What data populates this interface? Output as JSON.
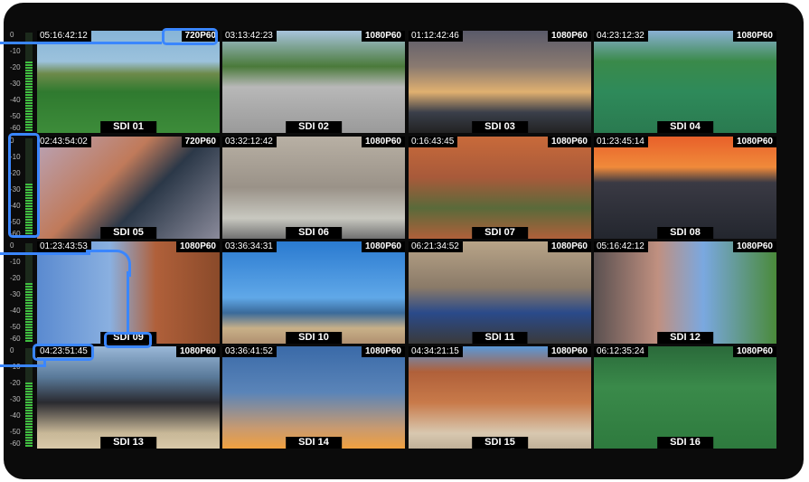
{
  "monitor": {
    "scale_labels": [
      "0",
      "-10",
      "-20",
      "-30",
      "-40",
      "-50",
      "-60"
    ],
    "tiles": [
      {
        "timecode": "05:16:42:12",
        "format": "720P60",
        "label": "SDI 01",
        "meter": 0.72
      },
      {
        "timecode": "03:13:42:23",
        "format": "1080P60",
        "label": "SDI 02"
      },
      {
        "timecode": "01:12:42:46",
        "format": "1080P60",
        "label": "SDI 03"
      },
      {
        "timecode": "04:23:12:32",
        "format": "1080P60",
        "label": "SDI 04"
      },
      {
        "timecode": "02:43:54:02",
        "format": "720P60",
        "label": "SDI 05",
        "meter": 0.55
      },
      {
        "timecode": "03:32:12:42",
        "format": "1080P60",
        "label": "SDI 06"
      },
      {
        "timecode": "0:16:43:45",
        "format": "1080P60",
        "label": "SDI 07"
      },
      {
        "timecode": "01:23:45:14",
        "format": "1080P60",
        "label": "SDI 08"
      },
      {
        "timecode": "01:23:43:53",
        "format": "1080P60",
        "label": "SDI 09",
        "meter": 0.6
      },
      {
        "timecode": "03:36:34:31",
        "format": "1080P60",
        "label": "SDI 10"
      },
      {
        "timecode": "06:21:34:52",
        "format": "1080P60",
        "label": "SDI 11"
      },
      {
        "timecode": "05:16:42:12",
        "format": "1080P60",
        "label": "SDI 12"
      },
      {
        "timecode": "04:23:51:45",
        "format": "1080P60",
        "label": "SDI 13",
        "meter": 0.65
      },
      {
        "timecode": "03:36:41:52",
        "format": "1080P60",
        "label": "SDI 14"
      },
      {
        "timecode": "04:34:21:15",
        "format": "1080P60",
        "label": "SDI 15"
      },
      {
        "timecode": "06:12:35:24",
        "format": "1080P60",
        "label": "SDI 16"
      }
    ]
  },
  "colors": {
    "highlight": "#3a86ff",
    "meter_green": "#3fbf3f",
    "background": "#0b0b0b"
  }
}
